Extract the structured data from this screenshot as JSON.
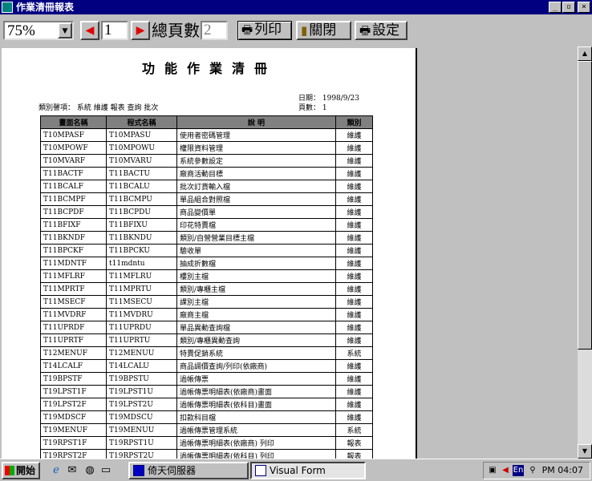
{
  "window": {
    "title": "作業清冊報表"
  },
  "toolbar": {
    "zoom": "75%",
    "page_number": "1",
    "total_pages_label": "總頁數",
    "total_pages": "2",
    "print_label": "列印",
    "close_label": "關閉",
    "settings_label": "設定"
  },
  "report": {
    "title": "功能作業清冊",
    "date": "日期： 1998/9/23",
    "page": "頁數： 1",
    "category": "類別韾項： 系統 維護 報表 查詢 批次",
    "columns": [
      "畫面名稱",
      "程式名稱",
      "說 明",
      "類別"
    ],
    "rows": [
      [
        "T10MPASF",
        "T10MPASU",
        "使用者密碼管理",
        "維護"
      ],
      [
        "T10MPOWF",
        "T10MPOWU",
        "權限資料管理",
        "維護"
      ],
      [
        "T10MVARF",
        "T10MVARU",
        "系統參數設定",
        "維護"
      ],
      [
        "T11BACTF",
        "T11BACTU",
        "廠商活動目標",
        "維護"
      ],
      [
        "T11BCALF",
        "T11BCALU",
        "批次訂貨輸入檔",
        "維護"
      ],
      [
        "T11BCMPF",
        "T11BCMPU",
        "單品組合對照檔",
        "維護"
      ],
      [
        "T11BCPDF",
        "T11BCPDU",
        "商品變價單",
        "維護"
      ],
      [
        "T11BFIXF",
        "T11BFIXU",
        "印花特賣檔",
        "維護"
      ],
      [
        "T11BKNDF",
        "T11BKNDU",
        "類別/自營營業目標主檔",
        "維護"
      ],
      [
        "T11BPCKF",
        "T11BPCKU",
        "驗收單",
        "維護"
      ],
      [
        "T11MDNTF",
        "t11mdntu",
        "抽成折數檔",
        "維護"
      ],
      [
        "T11MFLRF",
        "T11MFLRU",
        "樓別主檔",
        "維護"
      ],
      [
        "T11MPRTF",
        "T11MPRTU",
        "類別/專櫃主檔",
        "維護"
      ],
      [
        "T11MSECF",
        "T11MSECU",
        "課別主檔",
        "維護"
      ],
      [
        "T11MVDRF",
        "T11MVDRU",
        "廠商主檔",
        "維護"
      ],
      [
        "T11UPRDF",
        "T11UPRDU",
        "單品異動查詢檔",
        "維護"
      ],
      [
        "T11UPRTF",
        "T11UPRTU",
        "類別/專櫃異動查詢",
        "維護"
      ],
      [
        "T12MENUF",
        "T12MENUU",
        "特賣促銷系統",
        "系統"
      ],
      [
        "T14LCALF",
        "T14LCALU",
        "商品調價查詢/列印(依廠商)",
        "維護"
      ],
      [
        "T19BPSTF",
        "T19BPSTU",
        "過帳傳票",
        "維護"
      ],
      [
        "T19LPST1F",
        "T19LPST1U",
        "過帳傳票明細表(依廠商)畫面",
        "維護"
      ],
      [
        "T19LPST2F",
        "T19LPST2U",
        "過帳傳票明細表(依科目)畫面",
        "維護"
      ],
      [
        "T19MDSCF",
        "T19MDSCU",
        "扣款科目檔",
        "維護"
      ],
      [
        "T19MENUF",
        "T19MENUU",
        "過帳傳票管理系統",
        "系統"
      ],
      [
        "T19RPST1F",
        "T19RPST1U",
        "過帳傳票明細表(依廠商) 列印",
        "報表"
      ],
      [
        "T19RPST2F",
        "T19RPST2U",
        "過帳傳票明細表(依科目) 列印",
        "報表"
      ]
    ]
  },
  "taskbar": {
    "start_label": "開始",
    "tasks": [
      "倚天伺服器",
      "Visual Form"
    ],
    "tray_lang": "En",
    "clock": "PM 04:07"
  },
  "colors": {
    "titlebar": "#000080",
    "header_fill": "#808080",
    "nav_arrow": "#e00000"
  }
}
